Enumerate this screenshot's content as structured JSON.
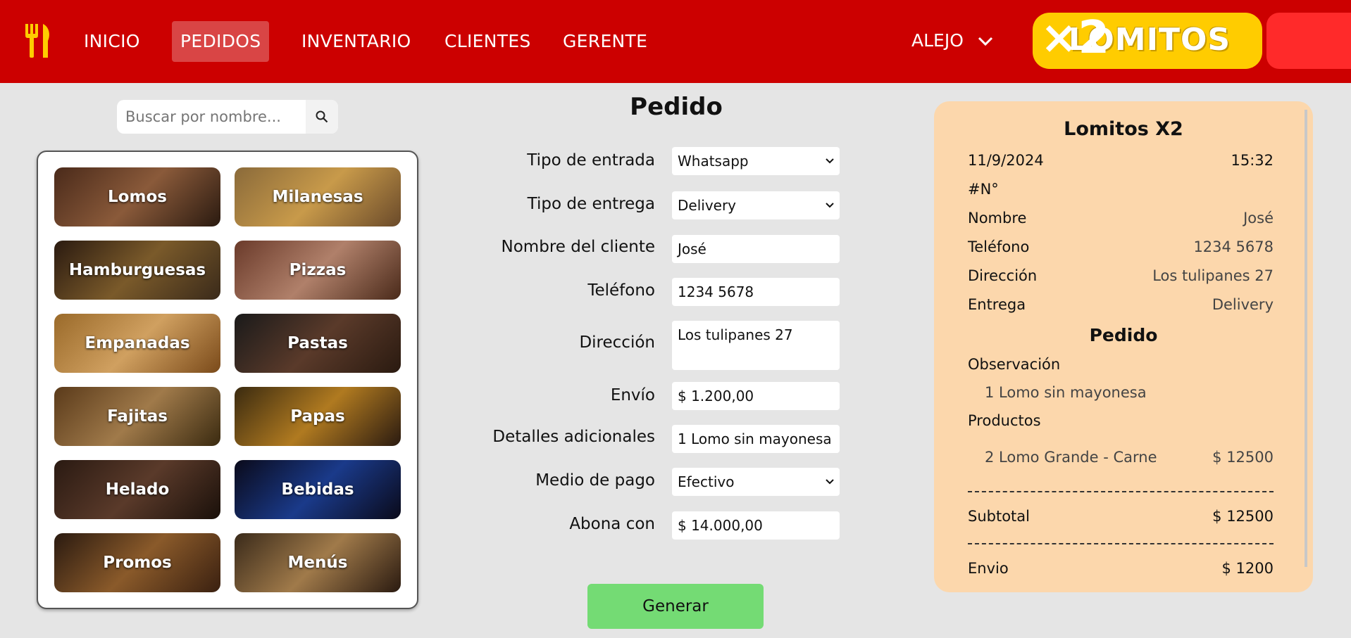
{
  "nav": {
    "items": [
      "INICIO",
      "PEDIDOS",
      "INVENTARIO",
      "CLIENTES",
      "GERENTE"
    ],
    "active": "PEDIDOS",
    "user": "ALEJO",
    "brand_text": "LOMITOS",
    "brand_badge": "×2",
    "brand_colors": {
      "header": "#cc0000",
      "pill": "#ffcc00",
      "badge": "#ff2a2a"
    }
  },
  "search": {
    "placeholder": "Buscar por nombre..."
  },
  "categories": [
    "Lomos",
    "Milanesas",
    "Hamburguesas",
    "Pizzas",
    "Empanadas",
    "Pastas",
    "Fajitas",
    "Papas",
    "Helado",
    "Bebidas",
    "Promos",
    "Menús"
  ],
  "form": {
    "title": "Pedido",
    "labels": {
      "entry_type": "Tipo de entrada",
      "delivery_type": "Tipo de entrega",
      "client_name": "Nombre del cliente",
      "phone": "Teléfono",
      "address": "Dirección",
      "shipping": "Envío",
      "details": "Detalles adicionales",
      "payment": "Medio de pago",
      "pays_with": "Abona con"
    },
    "values": {
      "entry_type": "Whatsapp",
      "delivery_type": "Delivery",
      "client_name": "José",
      "phone": "1234 5678",
      "address": "Los tulipanes 27",
      "shipping": "$ 1.200,00",
      "details": "1 Lomo sin mayonesa",
      "payment": "Efectivo",
      "pays_with": "$ 14.000,00"
    },
    "generate": "Generar",
    "generate_color": "#74db74"
  },
  "receipt": {
    "title": "Lomitos X2",
    "date": "11/9/2024",
    "time": "15:32",
    "number_label": "#N°",
    "name_label": "Nombre",
    "name": "José",
    "phone_label": "Teléfono",
    "phone": "1234 5678",
    "address_label": "Dirección",
    "address": "Los tulipanes 27",
    "delivery_label": "Entrega",
    "delivery": "Delivery",
    "order_heading": "Pedido",
    "observation_label": "Observación",
    "observation": "1 Lomo sin mayonesa",
    "products_label": "Productos",
    "product_name": "2 Lomo Grande - Carne",
    "product_price": "$ 12500",
    "subtotal_label": "Subtotal",
    "subtotal": "$ 12500",
    "shipping_label": "Envio",
    "shipping": "$ 1200",
    "bg_color": "#fcd7ac"
  }
}
